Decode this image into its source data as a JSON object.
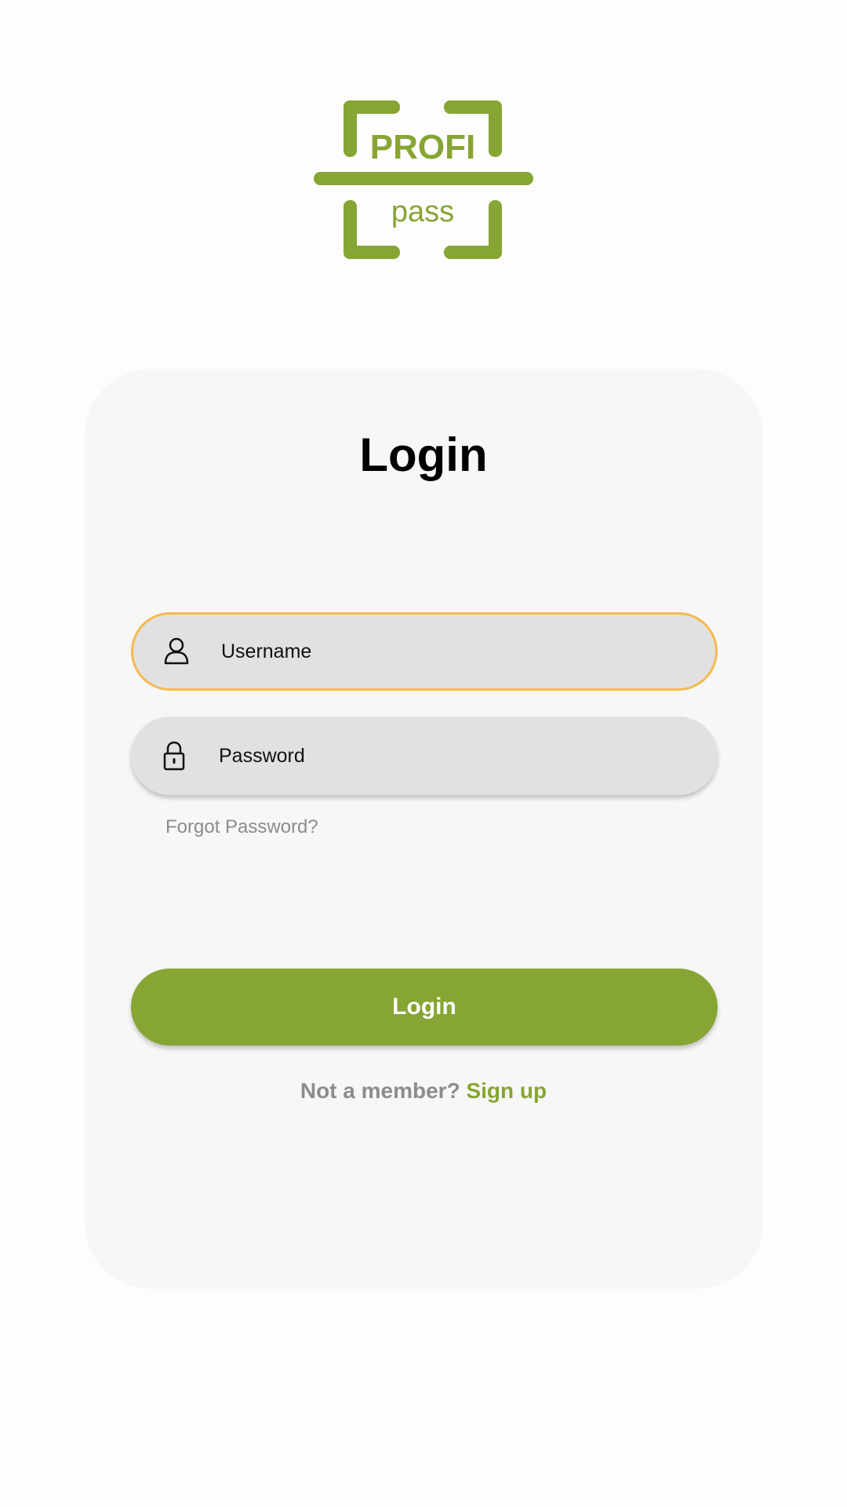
{
  "brand": {
    "logo_icon": "profi-pass-logo",
    "logo_top_text": "PROFI",
    "logo_bottom_text": "pass",
    "accent_color": "#86a533",
    "focus_color": "#f6b94f"
  },
  "login": {
    "title": "Login",
    "username": {
      "icon": "user-icon",
      "placeholder": "Username",
      "value": ""
    },
    "password": {
      "icon": "lock-icon",
      "placeholder": "Password",
      "value": ""
    },
    "forgot_password": "Forgot Password?",
    "submit_label": "Login",
    "signup_prompt": "Not a member?",
    "signup_link": "Sign up"
  }
}
